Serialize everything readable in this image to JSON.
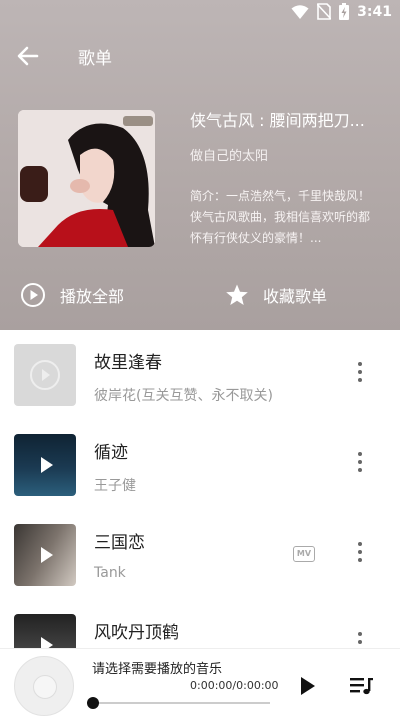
{
  "status": {
    "time": "3:41"
  },
  "header": {
    "title": "歌单"
  },
  "playlist": {
    "title": "侠气古风 : 腰间两把刀...",
    "author": "做自己的太阳",
    "description": "简介：一点浩然气，千里快哉风！侠气古风歌曲，我相信喜欢听的都怀有行侠仗义的豪情！..."
  },
  "actions": {
    "play_all": "播放全部",
    "favorite": "收藏歌单"
  },
  "songs": [
    {
      "title": "故里逢春",
      "artist": "彼岸花(互关互赞、永不取关)"
    },
    {
      "title": "循迹",
      "artist": "王子健"
    },
    {
      "title": "三国恋",
      "artist": "Tank",
      "badge": "MV"
    },
    {
      "title": "风吹丹顶鹤",
      "artist": ""
    }
  ],
  "player": {
    "prompt": "请选择需要播放的音乐",
    "time": "0:00:00/0:00:00",
    "progress": 0
  },
  "colors": {
    "header_bg": "#b3aaa9",
    "accent": "#111111"
  }
}
